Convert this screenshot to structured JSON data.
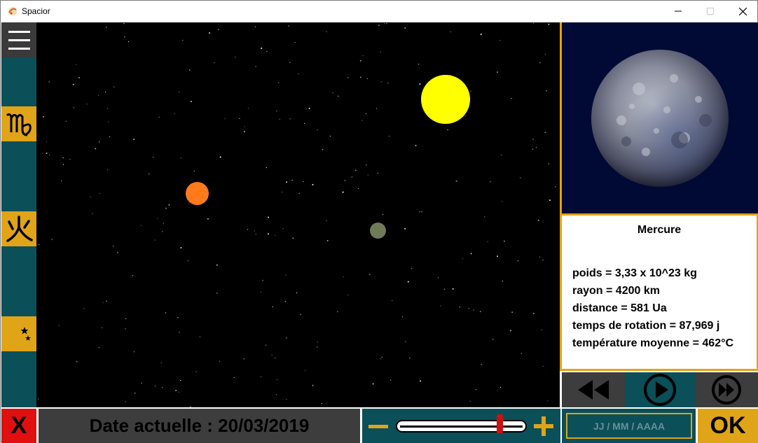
{
  "window": {
    "title": "Spacior"
  },
  "sidebar": {
    "items": [
      {
        "name": "virgo-sign",
        "glyph": "♍"
      },
      {
        "name": "fire-kanji",
        "glyph": "火"
      },
      {
        "name": "night-moon-stars",
        "glyph": "☾"
      }
    ]
  },
  "space": {
    "bodies": [
      {
        "name": "sun",
        "color": "#ffff00"
      },
      {
        "name": "orange-planet",
        "color": "#ff7a1a"
      },
      {
        "name": "mercury-planet",
        "color": "#6f7a57"
      }
    ]
  },
  "planet_info": {
    "name": "Mercure",
    "lines": [
      "poids = 3,33 x 10^23 kg",
      "rayon = 4200 km",
      "distance = 581 Ua",
      "temps de rotation = 87,969 j",
      "température moyenne = 462°C"
    ]
  },
  "controls": {
    "rewind": "rewind",
    "play": "play",
    "fast_forward": "fast-forward"
  },
  "bottom": {
    "close_label": "X",
    "date_text": "Date actuelle : 20/03/2019",
    "speed_level": 0.82,
    "date_placeholder": "JJ / MM / AAAA",
    "ok_label": "OK"
  },
  "colors": {
    "accent": "#e0a419",
    "teal": "#0b4f59",
    "close_red": "#e01010"
  }
}
